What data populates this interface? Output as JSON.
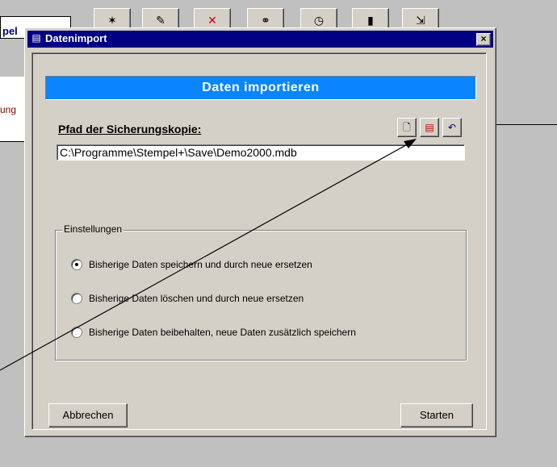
{
  "background": {
    "tab_text": "pel",
    "panel_text": "ung",
    "toolbar_icons": [
      "tool-icon-1",
      "tool-icon-2",
      "tool-icon-3",
      "tool-icon-4",
      "clock-icon",
      "chart-icon",
      "tool-icon-7"
    ]
  },
  "dialog": {
    "title": "Datenimport",
    "close_label": "×",
    "heading": "Daten importieren",
    "path_label": "Pfad der Sicherungskopie:",
    "path_value": "C:\\Programme\\Stempel+\\Save\\Demo2000.mdb",
    "path_buttons": [
      "new-file-icon",
      "open-file-icon",
      "undo-icon"
    ],
    "group_title": "Einstellungen",
    "options": [
      {
        "label": "Bisherige Daten speichern und durch neue ersetzen",
        "selected": true
      },
      {
        "label": "Bisherige Daten löschen und durch neue ersetzen",
        "selected": false
      },
      {
        "label": "Bisherige Daten beibehalten, neue Daten zusätzlich speichern",
        "selected": false
      }
    ],
    "cancel_button": "Abbrechen",
    "start_button": "Starten"
  },
  "colors": {
    "title_bar": "#000080",
    "heading_bar": "#0a84ff",
    "dialog_face": "#d4d0c8"
  }
}
